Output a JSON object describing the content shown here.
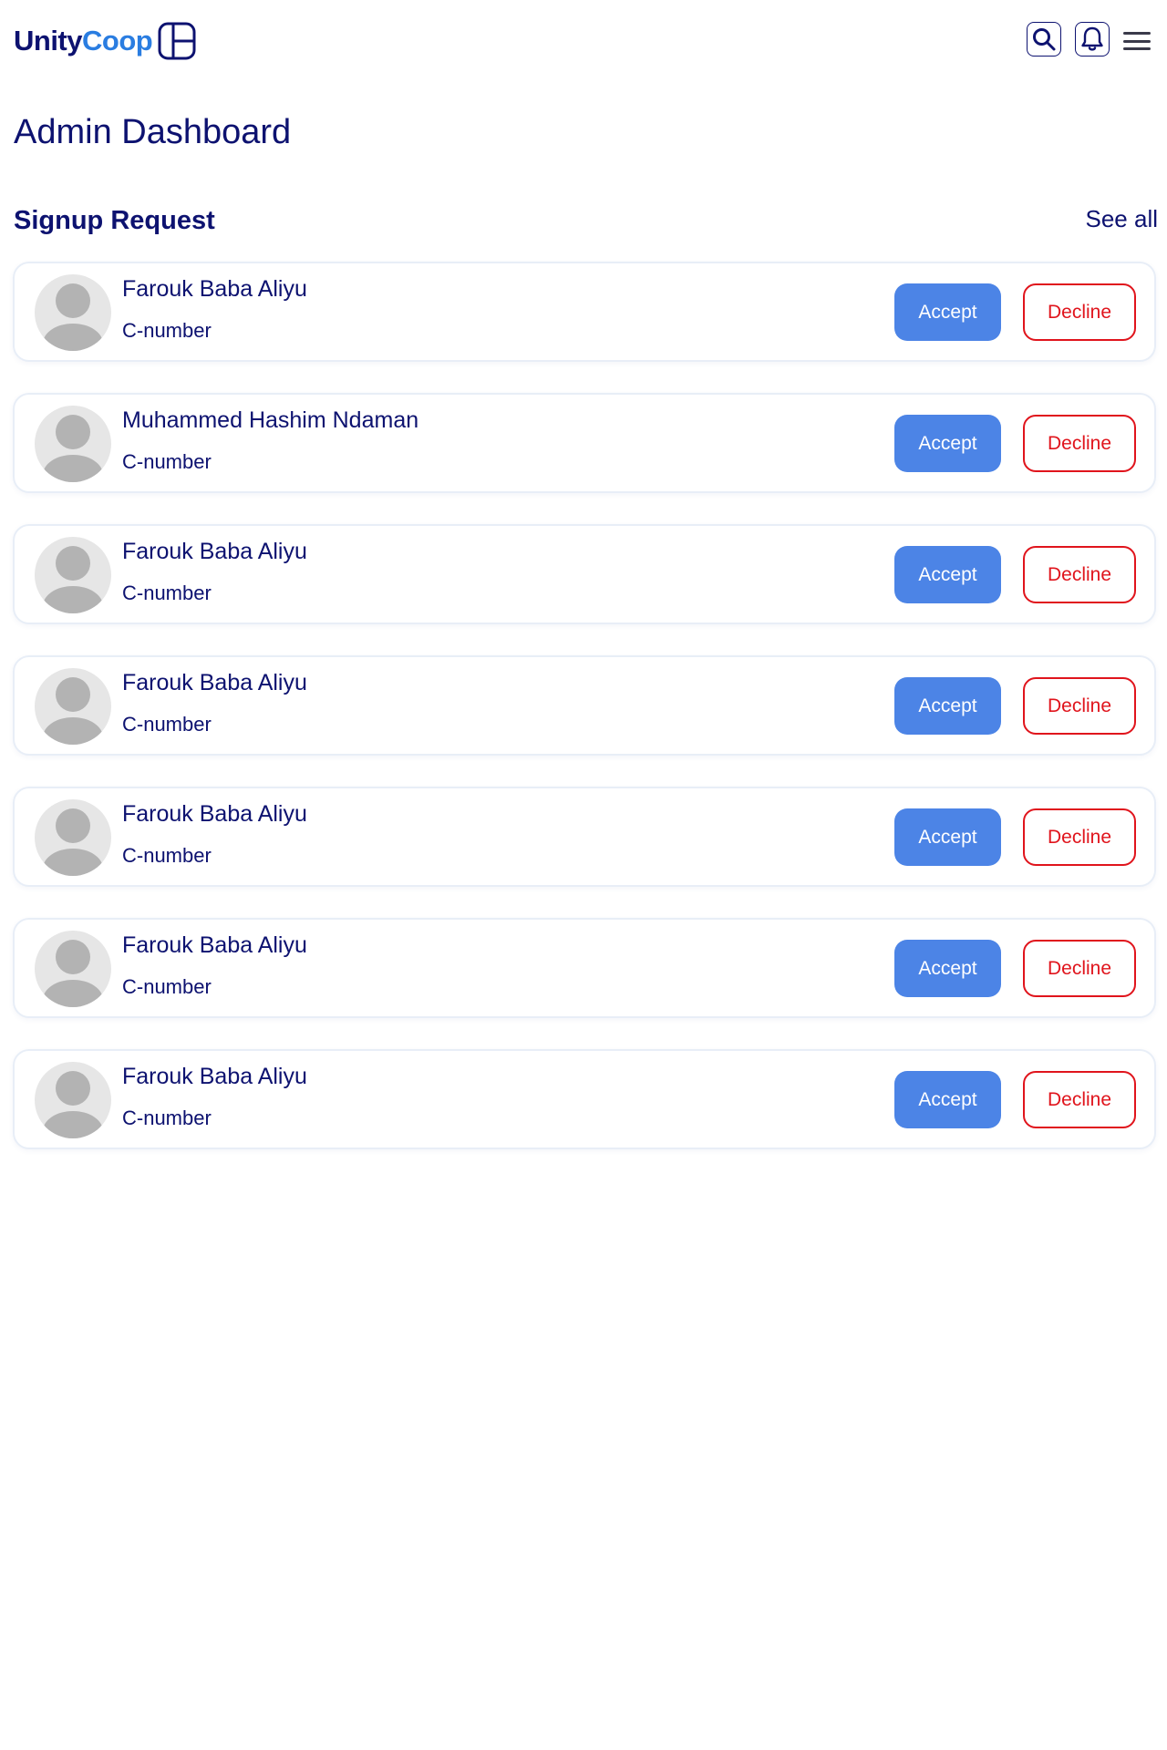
{
  "app": {
    "logo_part1": "Unity",
    "logo_part2": "Coop"
  },
  "header": {
    "icons": [
      "search-icon",
      "bell-icon",
      "hamburger-menu-icon"
    ]
  },
  "page": {
    "title": "Admin Dashboard"
  },
  "section": {
    "title": "Signup Request",
    "see_all": "See all"
  },
  "requests": [
    {
      "name": "Farouk Baba Aliyu",
      "id_label": "C-number",
      "accept": "Accept",
      "decline": "Decline"
    },
    {
      "name": "Muhammed Hashim Ndaman",
      "id_label": "C-number",
      "accept": "Accept",
      "decline": "Decline"
    },
    {
      "name": "Farouk Baba Aliyu",
      "id_label": "C-number",
      "accept": "Accept",
      "decline": "Decline"
    },
    {
      "name": "Farouk Baba Aliyu",
      "id_label": "C-number",
      "accept": "Accept",
      "decline": "Decline"
    },
    {
      "name": "Farouk Baba Aliyu",
      "id_label": "C-number",
      "accept": "Accept",
      "decline": "Decline"
    },
    {
      "name": "Farouk Baba Aliyu",
      "id_label": "C-number",
      "accept": "Accept",
      "decline": "Decline"
    },
    {
      "name": "Farouk Baba Aliyu",
      "id_label": "C-number",
      "accept": "Accept",
      "decline": "Decline"
    }
  ],
  "colors": {
    "navy": "#0d1270",
    "brand_blue": "#2a7de1",
    "accept_bg": "#4c84e6",
    "decline_red": "#e0141c"
  }
}
